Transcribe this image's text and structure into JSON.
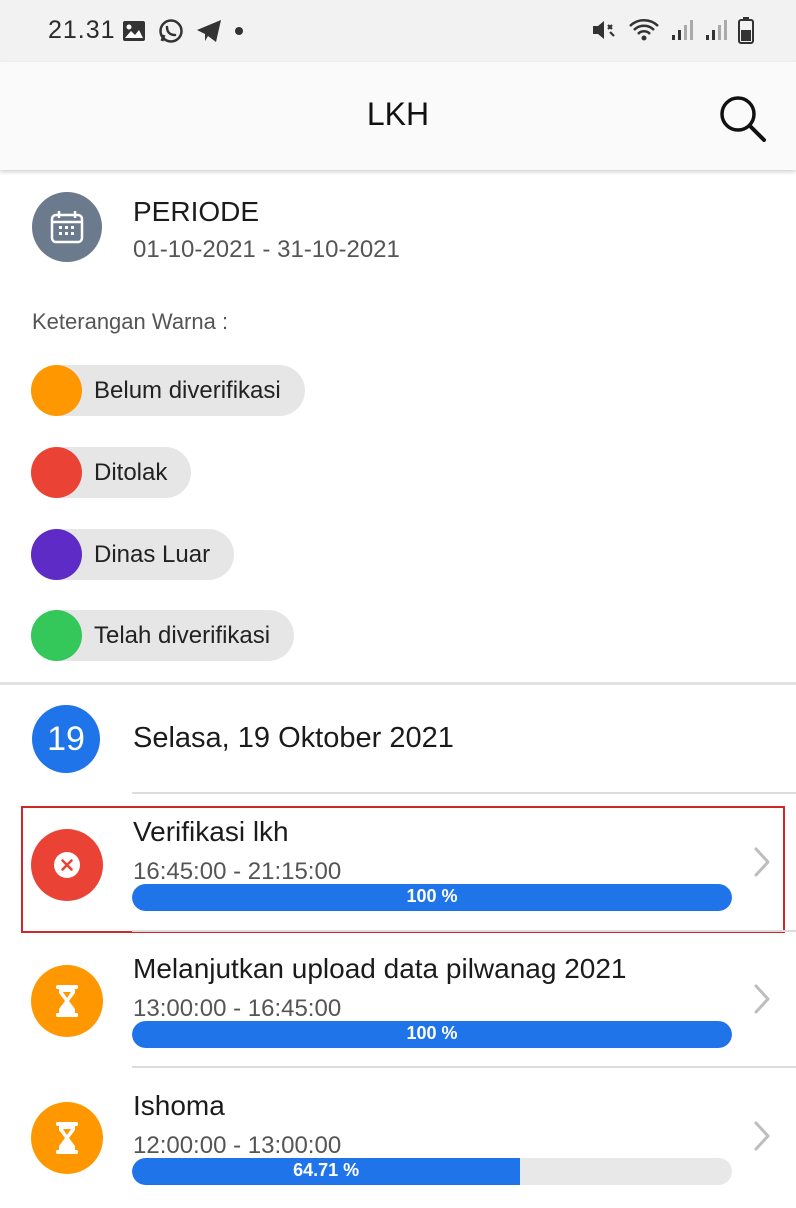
{
  "status_bar": {
    "time": "21.31",
    "left_icons": [
      "image-icon",
      "whatsapp-icon",
      "telegram-icon",
      "dot-icon"
    ],
    "right_icons": [
      "mute-vibrate-icon",
      "wifi-icon",
      "signal-icon",
      "signal-icon",
      "battery-icon"
    ]
  },
  "app_bar": {
    "title": "LKH",
    "search_icon": "search-icon"
  },
  "periode": {
    "icon": "calendar-icon",
    "title": "PERIODE",
    "range": "01-10-2021 - 31-10-2021"
  },
  "legend": {
    "label": "Keterangan Warna :",
    "items": [
      {
        "label": "Belum diverifikasi",
        "color": "#ff9800"
      },
      {
        "label": "Ditolak",
        "color": "#ea4335"
      },
      {
        "label": "Dinas Luar",
        "color": "#5e2bc6"
      },
      {
        "label": "Telah diverifikasi",
        "color": "#34c759"
      }
    ]
  },
  "date_header": {
    "day": "19",
    "text": "Selasa, 19 Oktober 2021"
  },
  "activities": [
    {
      "title": "Verifikasi lkh",
      "time": "16:45:00 - 21:15:00",
      "progress": 100,
      "progress_label": "100 %",
      "status_color": "#ea4335",
      "icon": "rejected-x-icon"
    },
    {
      "title": "Melanjutkan upload data pilwanag 2021",
      "time": "13:00:00 - 16:45:00",
      "progress": 100,
      "progress_label": "100 %",
      "status_color": "#ff9800",
      "icon": "hourglass-icon"
    },
    {
      "title": "Ishoma",
      "time": "12:00:00 - 13:00:00",
      "progress": 64.71,
      "progress_label": "64.71 %",
      "status_color": "#ff9800",
      "icon": "hourglass-icon"
    }
  ],
  "colors": {
    "accent": "#1f74ea"
  }
}
